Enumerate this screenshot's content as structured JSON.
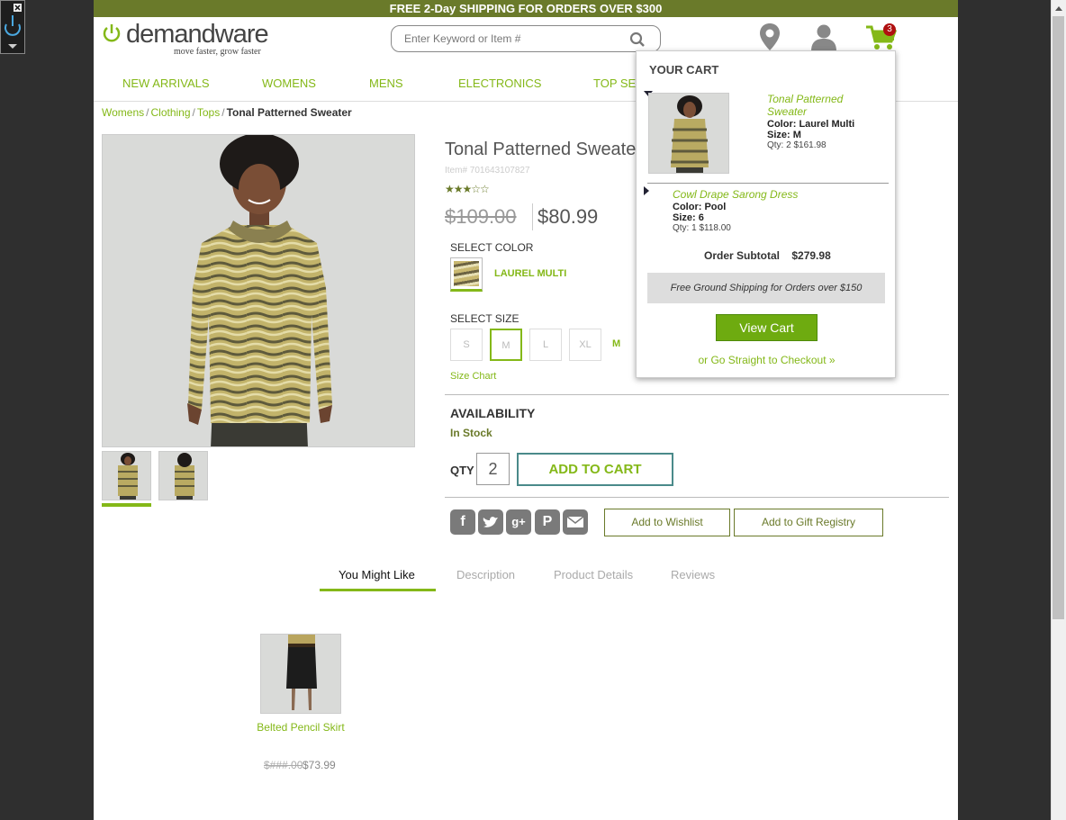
{
  "promo": {
    "text": "FREE 2-Day SHIPPING FOR ORDERS OVER $300"
  },
  "logo": {
    "name": "demandware",
    "tagline": "move faster, grow faster"
  },
  "search": {
    "placeholder": "Enter Keyword or Item #"
  },
  "cart": {
    "count": "3"
  },
  "nav": [
    "NEW ARRIVALS",
    "WOMENS",
    "MENS",
    "ELECTRONICS",
    "TOP SEL"
  ],
  "breadcrumb": {
    "items": [
      "Womens",
      "Clothing",
      "Tops"
    ],
    "current": "Tonal Patterned Sweater"
  },
  "product": {
    "title": "Tonal Patterned Sweater",
    "item_number": "Item# 701643107827",
    "stars": "★★★☆☆",
    "old_price": "$109.00",
    "new_price": "$80.99",
    "select_color_label": "SELECT COLOR",
    "color_name": "LAUREL MULTI",
    "select_size_label": "SELECT SIZE",
    "sizes": [
      "S",
      "M",
      "L",
      "XL"
    ],
    "selected_size": "M",
    "size_chart": "Size Chart",
    "availability_label": "AVAILABILITY",
    "availability": "In Stock",
    "qty_label": "QTY",
    "qty": "2",
    "add_to_cart": "ADD TO CART",
    "add_wishlist": "Add to Wishlist",
    "add_registry": "Add to Gift Registry"
  },
  "tabs": [
    "You Might Like",
    "Description",
    "Product Details",
    "Reviews"
  ],
  "recommendation": {
    "name": "Belted Pencil Skirt",
    "old_price": "$###.00",
    "price": "$73.99"
  },
  "minicart": {
    "title": "YOUR CART",
    "items": [
      {
        "name_line1": "Tonal Patterned",
        "name_line2": "Sweater",
        "color": "Color: Laurel Multi",
        "size": "Size: M",
        "qty": "Qty: 2 $161.98"
      },
      {
        "name": "Cowl Drape Sarong Dress",
        "color": "Color: Pool",
        "size": "Size: 6",
        "qty": "Qty: 1 $118.00"
      }
    ],
    "subtotal_label": "Order Subtotal",
    "subtotal": "$279.98",
    "shipping_note": "Free Ground Shipping for Orders over $150",
    "view_cart": "View Cart",
    "checkout": "or Go Straight to Checkout »"
  },
  "colors": {
    "accent": "#84b818",
    "promo_bg": "#6a7a2a",
    "badge": "#b01010"
  }
}
